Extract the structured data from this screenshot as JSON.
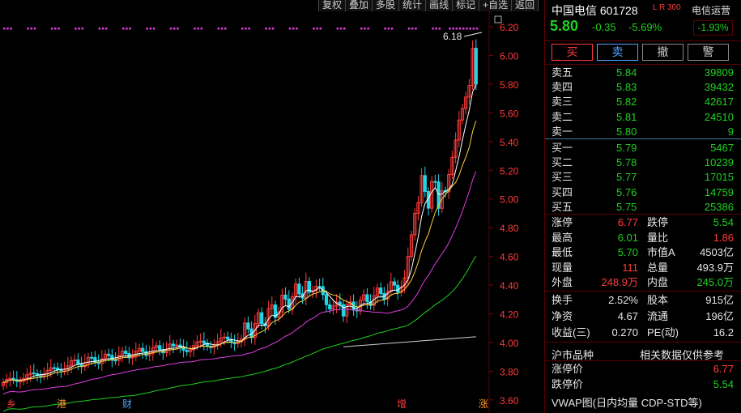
{
  "toolbar": [
    "复权",
    "叠加",
    "多股",
    "统计",
    "画线",
    "标记",
    "+自选",
    "返回"
  ],
  "chart": {
    "y_ticks": [
      "6.20",
      "6.00",
      "5.80",
      "5.60",
      "5.40",
      "5.20",
      "5.00",
      "4.80",
      "4.60",
      "4.40",
      "4.20",
      "4.00",
      "3.80",
      "3.60"
    ],
    "high_label": "6.18",
    "markers": [
      {
        "label": "乡",
        "color": "#ff3b3b"
      },
      {
        "label": "港",
        "color": "#ff9a2e"
      },
      {
        "label": "财",
        "color": "#4ea3ff"
      },
      {
        "label": "增",
        "color": "#ff3b3b"
      },
      {
        "label": "涨",
        "color": "#ff9a2e"
      }
    ],
    "colors": {
      "up": "#ff3b3b",
      "down": "#1fd6e6",
      "ma5": "#ffffff",
      "ma10": "#ffd23a",
      "ma20": "#e03ee0",
      "ma60": "#1fd11f",
      "ma120": "#cfcfcf",
      "signal": "#e03ee0"
    }
  },
  "header": {
    "name": "中国电信 601728",
    "tag": "L R 300",
    "sector": "电信运营",
    "sector_change": "-1.93%",
    "price": "5.80",
    "change": "-0.35",
    "change_pct": "-5.69%"
  },
  "buttons": {
    "buy": "买",
    "sell": "卖",
    "cancel": "撤",
    "warn": "警"
  },
  "sell_orders": [
    {
      "label": "卖五",
      "price": "5.84",
      "volume": "39809"
    },
    {
      "label": "卖四",
      "price": "5.83",
      "volume": "39432"
    },
    {
      "label": "卖三",
      "price": "5.82",
      "volume": "42617"
    },
    {
      "label": "卖二",
      "price": "5.81",
      "volume": "24510"
    },
    {
      "label": "卖一",
      "price": "5.80",
      "volume": "9"
    }
  ],
  "buy_orders": [
    {
      "label": "买一",
      "price": "5.79",
      "volume": "5467"
    },
    {
      "label": "买二",
      "price": "5.78",
      "volume": "10239"
    },
    {
      "label": "买三",
      "price": "5.77",
      "volume": "17015"
    },
    {
      "label": "买四",
      "price": "5.76",
      "volume": "14759"
    },
    {
      "label": "买五",
      "price": "5.75",
      "volume": "25386"
    }
  ],
  "stats": [
    {
      "l1": "涨停",
      "v1": "6.77",
      "c1": "red",
      "l2": "跌停",
      "v2": "5.54",
      "c2": "green"
    },
    {
      "l1": "最高",
      "v1": "6.01",
      "c1": "green",
      "l2": "量比",
      "v2": "1.86",
      "c2": "red"
    },
    {
      "l1": "最低",
      "v1": "5.70",
      "c1": "green",
      "l2": "市值A",
      "v2": "4503亿",
      "c2": "white"
    },
    {
      "l1": "现量",
      "v1": "111",
      "c1": "red",
      "l2": "总量",
      "v2": "493.9万",
      "c2": "white"
    },
    {
      "l1": "外盘",
      "v1": "248.9万",
      "c1": "red",
      "l2": "内盘",
      "v2": "245.0万",
      "c2": "green"
    }
  ],
  "fundamentals": [
    {
      "l1": "换手",
      "v1": "2.52%",
      "l2": "股本",
      "v2": "915亿"
    },
    {
      "l1": "净资",
      "v1": "4.67",
      "l2": "流通",
      "v2": "196亿"
    },
    {
      "l1": "收益(三)",
      "v1": "0.270",
      "l2": "PE(动)",
      "v2": "16.2"
    }
  ],
  "sh_section": {
    "label": "沪市品种",
    "note": "相关数据仅供参考"
  },
  "limits": [
    {
      "label": "涨停价",
      "value": "6.77",
      "color": "red"
    },
    {
      "label": "跌停价",
      "value": "5.54",
      "color": "green"
    }
  ],
  "vwap": "VWAP图(日内均量 CDP-STD等)"
}
